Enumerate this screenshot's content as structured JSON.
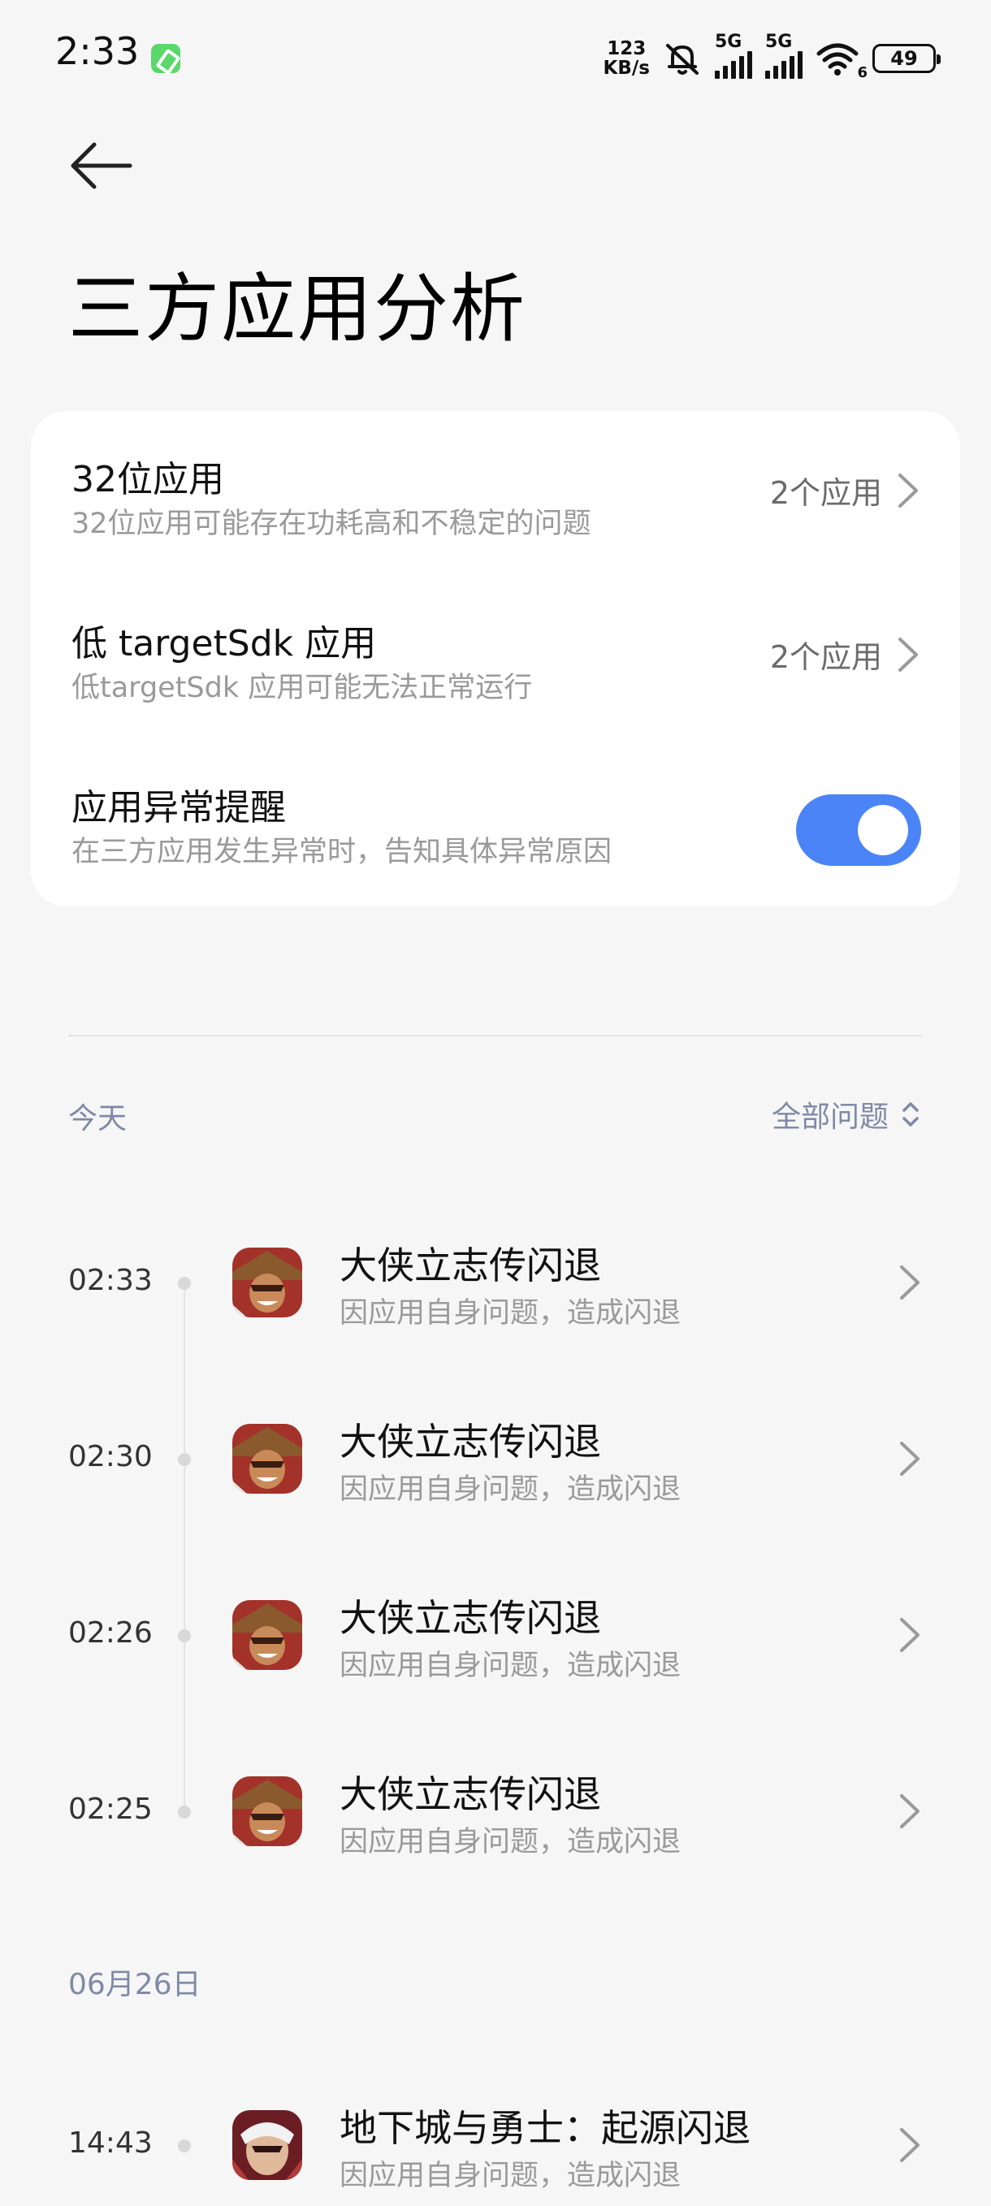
{
  "status": {
    "time": "2:33",
    "net_speed_value": "123",
    "net_speed_unit": "KB/s",
    "sim1": "5G",
    "sim2": "5G",
    "wifi_level": "6",
    "battery": "49"
  },
  "page": {
    "title": "三方应用分析"
  },
  "settings": {
    "items": [
      {
        "title": "32位应用",
        "subtitle": "32位应用可能存在功耗高和不稳定的问题",
        "value": "2个应用"
      },
      {
        "title": "低 targetSdk 应用",
        "subtitle": "低targetSdk 应用可能无法正常运行",
        "value": "2个应用"
      },
      {
        "title": "应用异常提醒",
        "subtitle": "在三方应用发生异常时，告知具体异常原因",
        "enabled": true
      }
    ]
  },
  "log": {
    "today_label": "今天",
    "filter_label": "全部问题",
    "today_events": [
      {
        "time": "02:33",
        "title": "大侠立志传闪退",
        "subtitle": "因应用自身问题，造成闪退"
      },
      {
        "time": "02:30",
        "title": "大侠立志传闪退",
        "subtitle": "因应用自身问题，造成闪退"
      },
      {
        "time": "02:26",
        "title": "大侠立志传闪退",
        "subtitle": "因应用自身问题，造成闪退"
      },
      {
        "time": "02:25",
        "title": "大侠立志传闪退",
        "subtitle": "因应用自身问题，造成闪退"
      }
    ],
    "earlier_label": "06月26日",
    "earlier_events": [
      {
        "time": "14:43",
        "title": "地下城与勇士：起源闪退",
        "subtitle": "因应用自身问题，造成闪退"
      }
    ]
  },
  "icons": {
    "back": "arrow-left-icon",
    "chevron": "chevron-right-icon",
    "sort": "sort-updown-icon",
    "app1": "dxlzz-app-icon",
    "app2": "dnf-app-icon"
  },
  "colors": {
    "accent": "#4b84f7",
    "label": "#7e8aa6",
    "secondary_text": "#9a9a9a"
  }
}
